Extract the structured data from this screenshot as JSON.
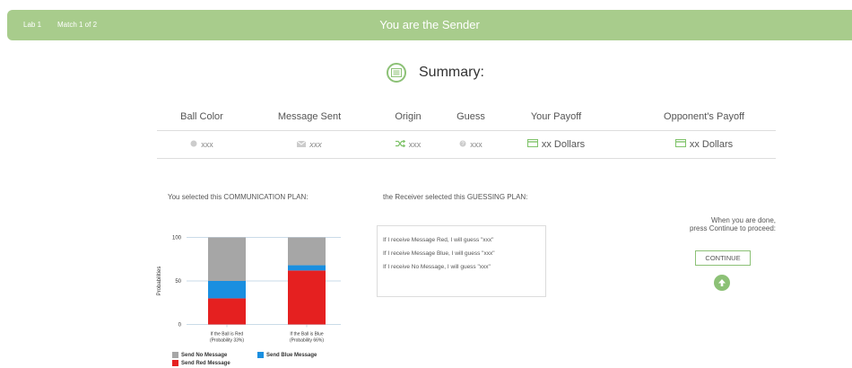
{
  "header": {
    "lab": "Lab 1",
    "match": "Match 1 of 2",
    "title": "You are the Sender",
    "color": "#a8cc8c"
  },
  "summary": {
    "label": "Summary:",
    "icon": "list-icon"
  },
  "table": {
    "headers": [
      "Ball Color",
      "Message Sent",
      "Origin",
      "Guess",
      "Your Payoff",
      "Opponent's Payoff"
    ],
    "row": [
      {
        "icon": "circle-icon",
        "value": "xxx"
      },
      {
        "icon": "envelope-icon",
        "value": "xxx"
      },
      {
        "icon": "shuffle-icon",
        "value": "xxx"
      },
      {
        "icon": "help-circle-icon",
        "value": "xxx"
      },
      {
        "icon": "money-icon",
        "value": "xx Dollars"
      },
      {
        "icon": "money-icon",
        "value": "xx Dollars"
      }
    ]
  },
  "communication_plan": {
    "label": "You selected this COMMUNICATION PLAN:"
  },
  "guessing_plan": {
    "label": "the Receiver selected this GUESSING PLAN:",
    "lines": [
      "If I receive Message Red, I will guess \"xxx\"",
      "If I receive Message Blue, I will guess \"xxx\"",
      "If I receive No Message, I will guess \"xxx\""
    ]
  },
  "instructions": {
    "line1": "When you are done,",
    "line2": "press Continue to proceed:"
  },
  "continue_button": {
    "label": "CONTINUE",
    "accent": "#8cc176"
  },
  "chart_data": {
    "type": "bar",
    "stacked": true,
    "categories": [
      [
        "If the Ball is Red",
        "(Probability 33%)"
      ],
      [
        "If the Ball is Blue",
        "(Probability 66%)"
      ]
    ],
    "series": [
      {
        "name": "Send Red Message",
        "color": "#e52020",
        "values": [
          30,
          62
        ]
      },
      {
        "name": "Send Blue Message",
        "color": "#1a8fe0",
        "values": [
          20,
          6
        ]
      },
      {
        "name": "Send No Message",
        "color": "#a6a6a6",
        "values": [
          50,
          32
        ]
      }
    ],
    "ylabel": "Probabilities",
    "yticks": [
      0,
      50,
      100
    ],
    "ylim": [
      0,
      100
    ],
    "grid": true
  }
}
